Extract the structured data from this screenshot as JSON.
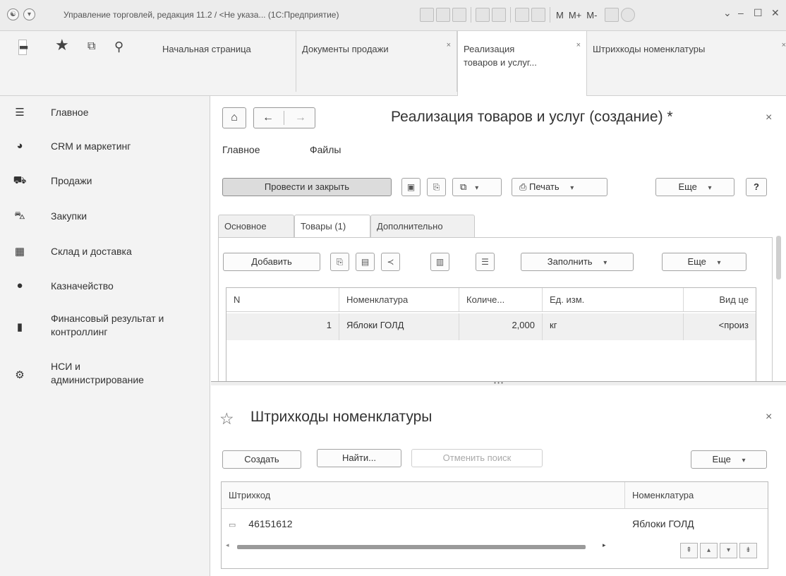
{
  "window": {
    "title": "Управление торговлей, редакция 11.2 / <Не указа... (1С:Предприятие)",
    "buttons": [
      "M",
      "M+",
      "M-"
    ]
  },
  "quick_icons": [
    "apps-grid-icon",
    "star-icon",
    "history-icon",
    "search-icon"
  ],
  "tabs": [
    {
      "label": "Начальная страница"
    },
    {
      "label": "Документы продажи",
      "close": "×"
    },
    {
      "label_line1": "Реализация",
      "label_line2": "товаров и услуг...",
      "close": "×"
    },
    {
      "label": "Штрихкоды номенклатуры",
      "close": "×"
    }
  ],
  "sidebar": {
    "items": [
      {
        "label": "Главное",
        "icon": "menu-lines-icon"
      },
      {
        "label": "CRM и маркетинг",
        "icon": "pie-chart-icon"
      },
      {
        "label": "Продажи",
        "icon": "shopping-bag-icon"
      },
      {
        "label": "Закупки",
        "icon": "cart-icon"
      },
      {
        "label": "Склад и доставка",
        "icon": "warehouse-icon"
      },
      {
        "label": "Казначейство",
        "icon": "coin-icon"
      },
      {
        "label_line1": "Финансовый результат и",
        "label_line2": "контроллинг",
        "icon": "bar-chart-icon"
      },
      {
        "label_line1": "НСИ и",
        "label_line2": "администрирование",
        "icon": "gear-icon"
      }
    ]
  },
  "doc": {
    "title": "Реализация товаров и услуг (создание) *",
    "menu": [
      "Главное",
      "Файлы"
    ],
    "toolbar": {
      "post_close": "Провести и закрыть",
      "print": "Печать",
      "more": "Еще",
      "help": "?"
    },
    "tabs": [
      "Основное",
      "Товары (1)",
      "Дополнительно"
    ],
    "goods_toolbar": {
      "add": "Добавить",
      "fill": "Заполнить",
      "more": "Еще"
    },
    "table": {
      "columns": [
        "N",
        "Номенклатура",
        "Количе...",
        "Ед. изм.",
        "Вид це"
      ],
      "rows": [
        {
          "n": "1",
          "item": "Яблоки ГОЛД",
          "qty": "2,000",
          "unit": "кг",
          "price_type": "<произ"
        }
      ]
    }
  },
  "barcodes": {
    "title": "Штрихкоды номенклатуры",
    "toolbar": {
      "create": "Создать",
      "find": "Найти...",
      "cancel_search": "Отменить поиск",
      "more": "Еще"
    },
    "table": {
      "columns": [
        "Штрихкод",
        "Номенклатура"
      ],
      "rows": [
        {
          "barcode": "46151612",
          "item": "Яблоки ГОЛД"
        }
      ]
    }
  }
}
